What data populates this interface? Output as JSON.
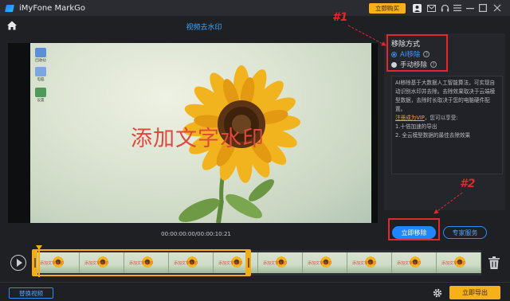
{
  "app": {
    "name": "iMyFone MarkGo"
  },
  "titlebar": {
    "buy_label": "立即购买"
  },
  "header": {
    "title": "视频去水印"
  },
  "video": {
    "watermark_text": "添加文字水印",
    "desktop_labels": [
      "回收站",
      "电脑",
      "设置"
    ],
    "timecode": "00:00:00:00/00:00:10:21"
  },
  "panel": {
    "mode_title": "移除方式",
    "options": [
      {
        "label": "AI移除",
        "selected": true
      },
      {
        "label": "手动移除",
        "selected": false
      }
    ],
    "description": "AI移除基于大数据人工智能算法，可实现自动识别水印并去除。去除效果取决于云端模型数据，去除时长取决于您的电脑硬件配置。",
    "vip_link": "注册成为VIP",
    "vip_suffix": "，您可以享受:",
    "benefits": [
      "1.十倍加速的导出",
      "2. 全云模型数据的最佳去除效果"
    ],
    "remove_button": "立即移除",
    "service_button": "专家服务"
  },
  "annotations": {
    "one": "#1",
    "two": "#2"
  },
  "timeline": {
    "thumb_text": "添加文字水印",
    "selection_end_fraction": 0.48
  },
  "footer": {
    "replace_button": "替换视频",
    "export_button": "立即导出"
  },
  "colors": {
    "accent": "#1f86ff",
    "highlight": "#f6b01c",
    "annotation": "#e0282d",
    "watermark": "#e0473d"
  }
}
